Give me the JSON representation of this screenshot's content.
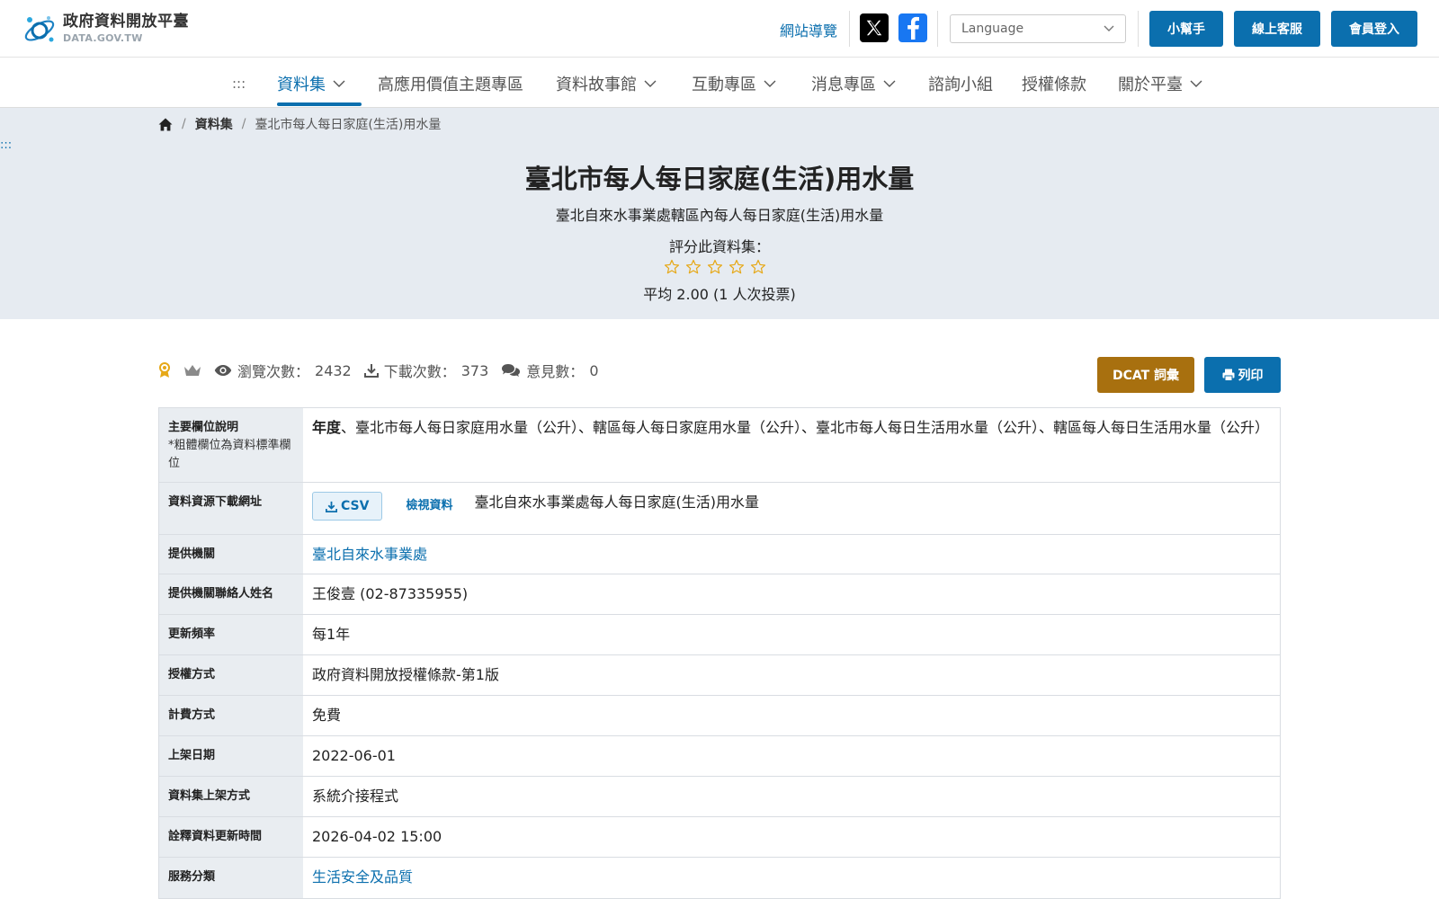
{
  "header": {
    "logo_zh": "政府資料開放平臺",
    "logo_en": "DATA.GOV.TW",
    "sitemap": "網站導覽",
    "language_placeholder": "Language",
    "buttons": {
      "helper": "小幫手",
      "support": "線上客服",
      "login": "會員登入"
    }
  },
  "nav": {
    "accesskey": ":::",
    "items": [
      {
        "label": "資料集"
      },
      {
        "label": "高應用價值主題專區"
      },
      {
        "label": "資料故事館"
      },
      {
        "label": "互動專區"
      },
      {
        "label": "消息專區"
      },
      {
        "label": "諮詢小組"
      },
      {
        "label": "授權條款"
      },
      {
        "label": "關於平臺"
      }
    ]
  },
  "breadcrumb": {
    "level1": "資料集",
    "current": "臺北市每人每日家庭(生活)用水量"
  },
  "hero": {
    "accesskey": ":::",
    "title": "臺北市每人每日家庭(生活)用水量",
    "subtitle": "臺北自來水事業處轄區內每人每日家庭(生活)用水量",
    "rate_label": "評分此資料集：",
    "rating": {
      "value": 0,
      "max": 5
    },
    "average": "平均 2.00 (1 人次投票)"
  },
  "stats": {
    "views_label": "瀏覽次數：",
    "views": "2432",
    "downloads_label": "下載次數：",
    "downloads": "373",
    "comments_label": "意見數：",
    "comments": "0"
  },
  "actions": {
    "dcat": "DCAT 詞彙",
    "print": "列印"
  },
  "table": {
    "main_fields": {
      "label": "主要欄位說明",
      "note": "*粗體欄位為資料標準欄位",
      "bold": "年度",
      "rest": "、臺北市每人每日家庭用水量（公升）、轄區每人每日家庭用水量（公升）、臺北市每人每日生活用水量（公升）、轄區每人每日生活用水量（公升）"
    },
    "resource": {
      "label": "資料資源下載網址",
      "csv": "CSV",
      "view": "檢視資料",
      "name": "臺北自來水事業處每人每日家庭(生活)用水量"
    },
    "rows": [
      {
        "label": "提供機關",
        "value": "臺北自來水事業處",
        "link": true
      },
      {
        "label": "提供機關聯絡人姓名",
        "value": "王俊壹 (02-87335955)",
        "link": false
      },
      {
        "label": "更新頻率",
        "value": "每1年",
        "link": false
      },
      {
        "label": "授權方式",
        "value": "政府資料開放授權條款-第1版",
        "link": false
      },
      {
        "label": "計費方式",
        "value": "免費",
        "link": false
      },
      {
        "label": "上架日期",
        "value": "2022-06-01",
        "link": false
      },
      {
        "label": "資料集上架方式",
        "value": "系統介接程式",
        "link": false
      },
      {
        "label": "詮釋資料更新時間",
        "value": "2026-04-02 15:00",
        "link": false
      },
      {
        "label": "服務分類",
        "value": "生活安全及品質",
        "link": true
      }
    ]
  },
  "colors": {
    "primary": "#0b6fae",
    "dcat": "#a8700f",
    "hero_bg": "#e6ebf1",
    "table_head": "#e9edf1",
    "star": "#e6a817"
  }
}
